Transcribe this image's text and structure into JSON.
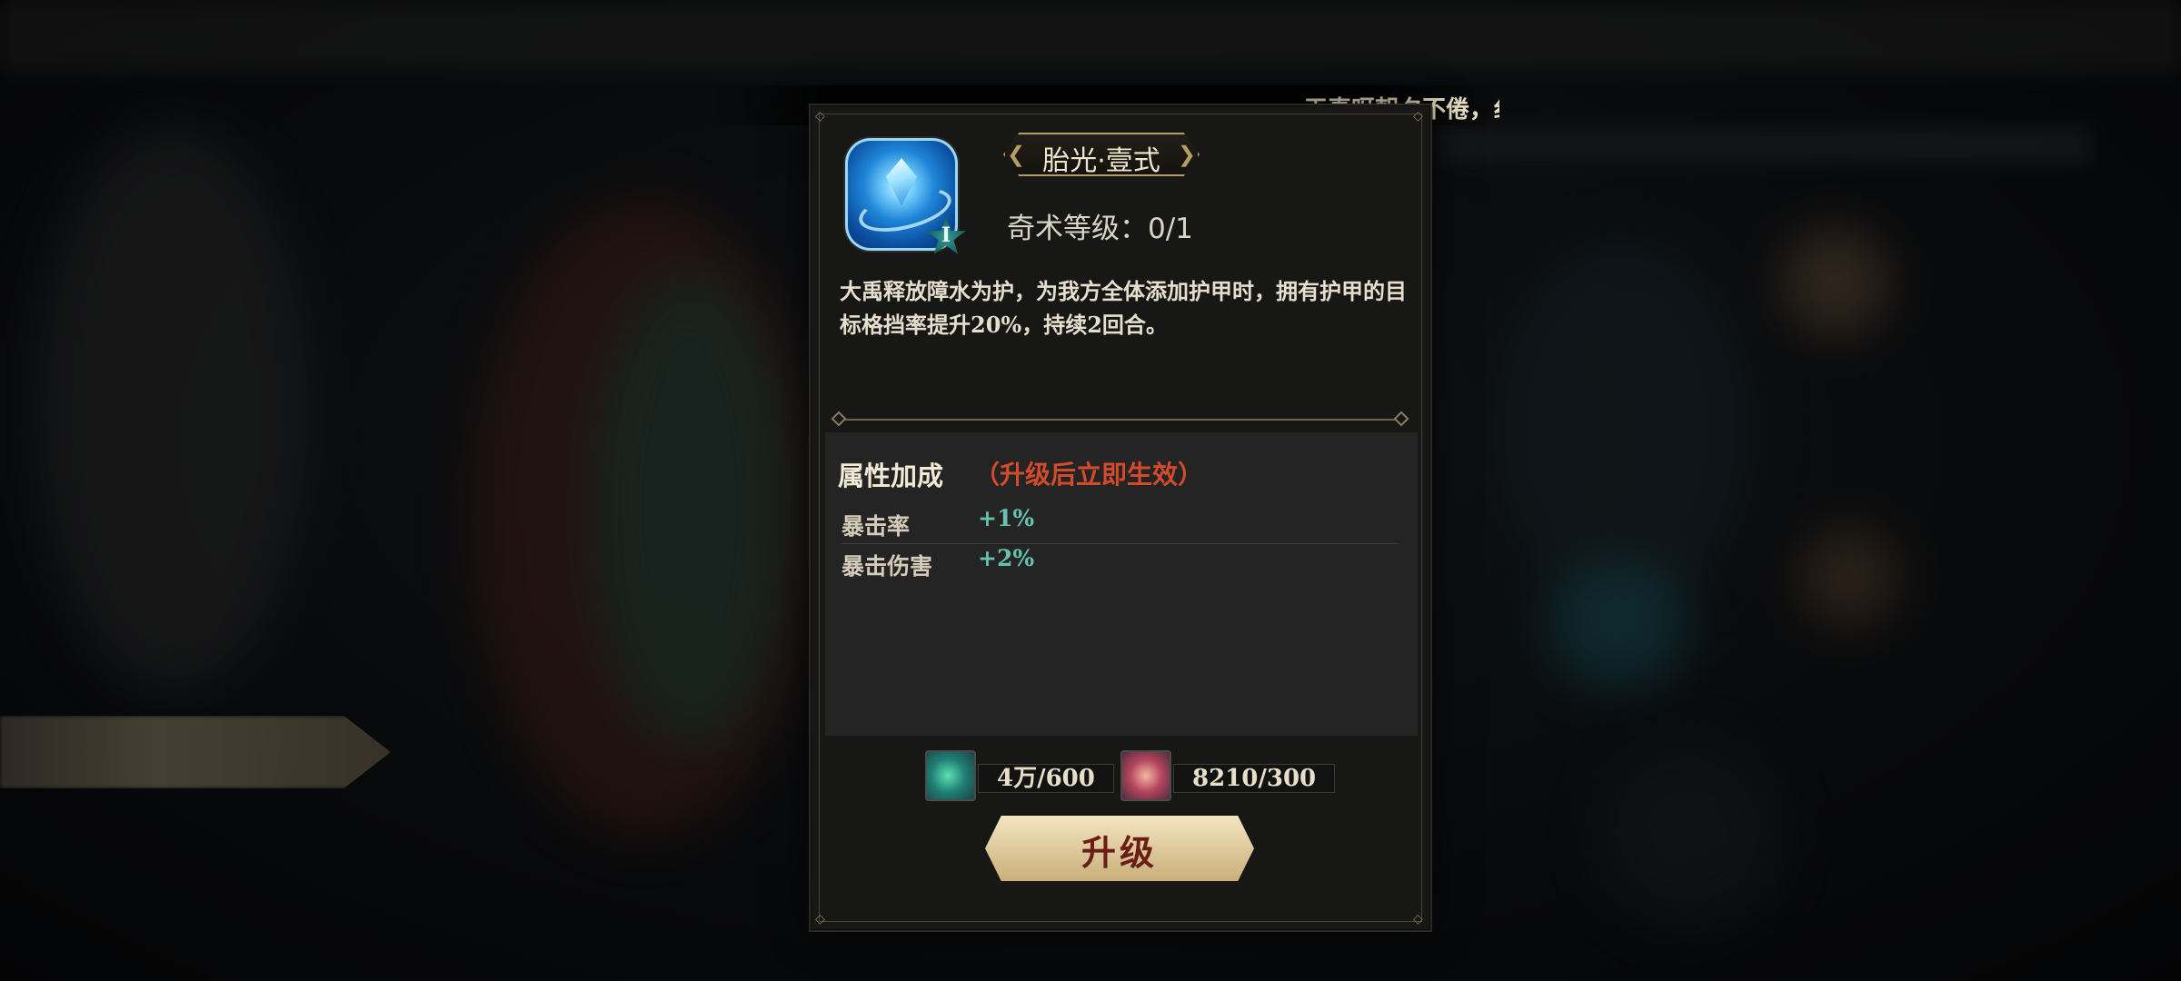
{
  "ticker": {
    "text": "天真呀朝夕不倦，纟"
  },
  "skill": {
    "icon": "water-crystal-icon",
    "badge": "Ⅰ",
    "name": "胎光·壹式",
    "level_text": "奇术等级：0/1",
    "description": "大禹释放障水为护，为我方全体添加护甲时，拥有护甲的目标格挡率提升20%，持续2回合。"
  },
  "attributes": {
    "title": "属性加成",
    "note": "（升级后立即生效）",
    "rows": [
      {
        "label": "暴击率",
        "value": "+1%"
      },
      {
        "label": "暴击伤害",
        "value": "+2%"
      }
    ]
  },
  "costs": [
    {
      "icon": "green-jade-material-icon",
      "amount": "4万/600"
    },
    {
      "icon": "red-feather-material-icon",
      "amount": "8210/300"
    }
  ],
  "upgrade_button": {
    "label": "升级"
  },
  "colors": {
    "accent_gold": "#b79c66",
    "note_red": "#d24b2a",
    "bonus_teal": "#66c2b0",
    "button_text": "#6b1e16"
  }
}
